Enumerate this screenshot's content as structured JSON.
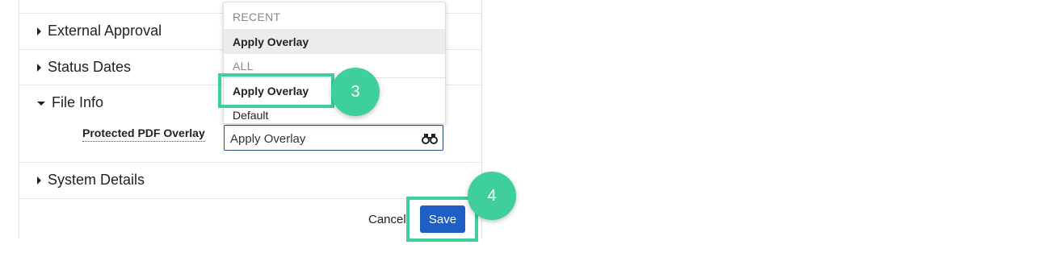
{
  "sections": {
    "external_approval": "External Approval",
    "status_dates": "Status Dates",
    "file_info": "File Info",
    "system_details": "System Details"
  },
  "file_info": {
    "field_label": "Protected PDF Overlay",
    "field_value": "Apply Overlay",
    "lookup_icon": "binoculars-icon"
  },
  "dropdown": {
    "recent_header": "RECENT",
    "recent_items": [
      "Apply Overlay"
    ],
    "all_header": "ALL",
    "all_items": [
      "Apply Overlay",
      "Default"
    ]
  },
  "footer": {
    "cancel_label": "Cancel",
    "save_label": "Save"
  },
  "callouts": {
    "step_3": "3",
    "step_4": "4"
  },
  "colors": {
    "accent_highlight": "#3ecf9b",
    "save_button": "#1d5fc5",
    "lookup_border": "#2d4d8a"
  }
}
